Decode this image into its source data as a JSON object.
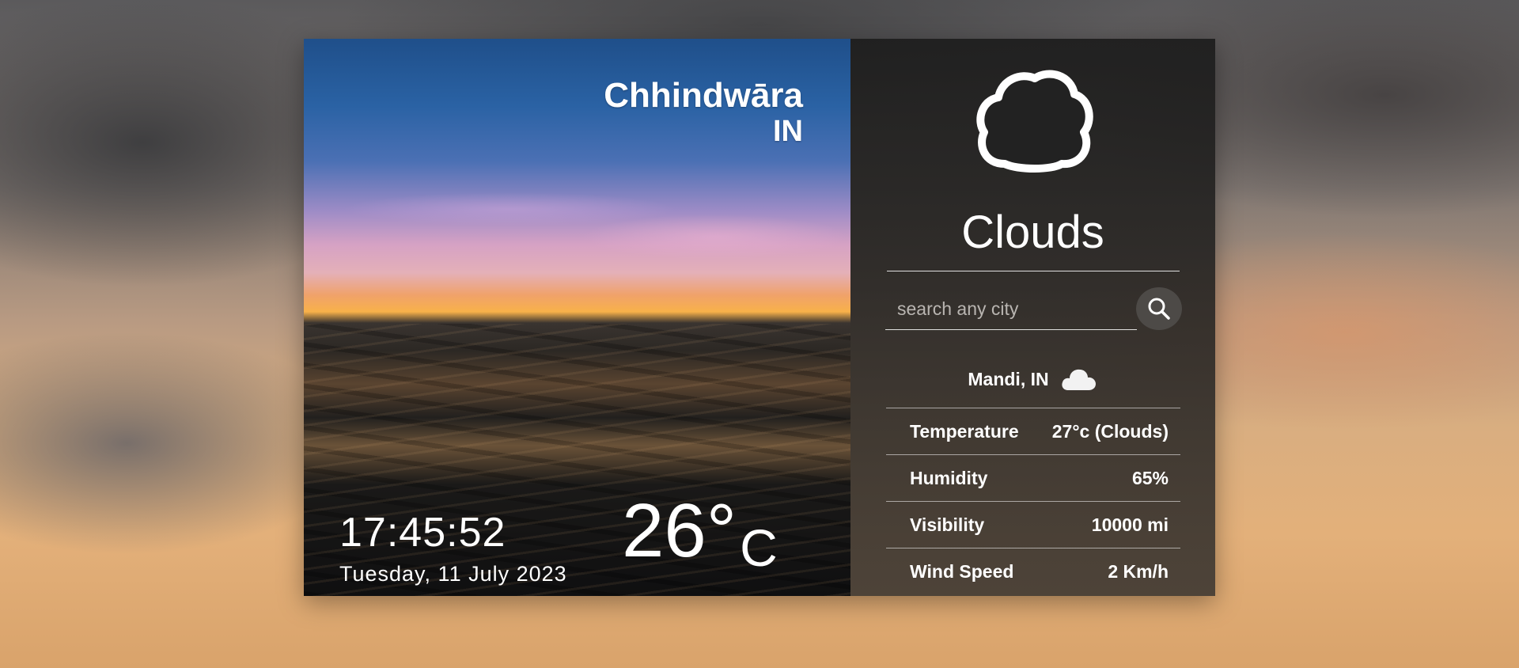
{
  "current": {
    "city": "Chhindwāra",
    "country": "IN",
    "time": "17:45:52",
    "date": "Tuesday, 11 July 2023",
    "temperature": "26°",
    "unit": "C"
  },
  "panel": {
    "icon": "cloud-icon",
    "condition": "Clouds",
    "search": {
      "placeholder": "search any city",
      "value": "",
      "button_icon": "search-icon"
    },
    "result": {
      "location": "Mandi, IN",
      "icon": "cloud-icon"
    },
    "details": [
      {
        "label": "Temperature",
        "value": "27°c (Clouds)"
      },
      {
        "label": "Humidity",
        "value": "65%"
      },
      {
        "label": "Visibility",
        "value": "10000 mi"
      },
      {
        "label": "Wind Speed",
        "value": "2 Km/h"
      }
    ]
  },
  "colors": {
    "panel_background": "#1e1e1e",
    "text": "#ffffff",
    "search_button": "#4d4a47"
  }
}
